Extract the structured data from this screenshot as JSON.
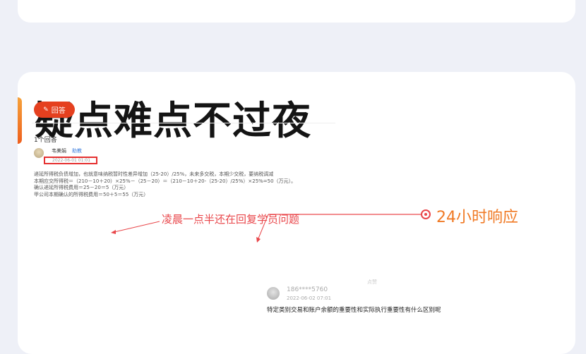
{
  "headline": "疑点难点不过夜",
  "screenshot": {
    "answer_button": "回答",
    "answer_count": "1个回答",
    "user_name": "韦美娟",
    "user_role": "助教",
    "answer_date": "2022-06-01 01:01",
    "body_lines": [
      "递延所得税负债增加，也就意味纳税暂时性差异增加（25-20）/25%，未来多交税，本期少交税，要纳税调减",
      "本期应交所得税＝（210－10＋20）×25%－（25－20）＝（210－10＋20-（25-20）/25%）×25%=50（万元）。",
      "确认递延所得税费用＝25－20＝5（万元）",
      "甲公司本期确认的所得税费用＝50＋5＝55（万元）"
    ],
    "like_hint": "点赞"
  },
  "annotations": {
    "note": "凌晨一点半还在回复学员问题",
    "response_label": "24小时响应",
    "accent_color": "#e9474b",
    "highlight_color": "#f07a25"
  },
  "second_question": {
    "user": "186****5760",
    "date": "2022-06-02 07:01",
    "question": "特定类别交易和账户余额的重要性和实际执行重要性有什么区别呢"
  }
}
